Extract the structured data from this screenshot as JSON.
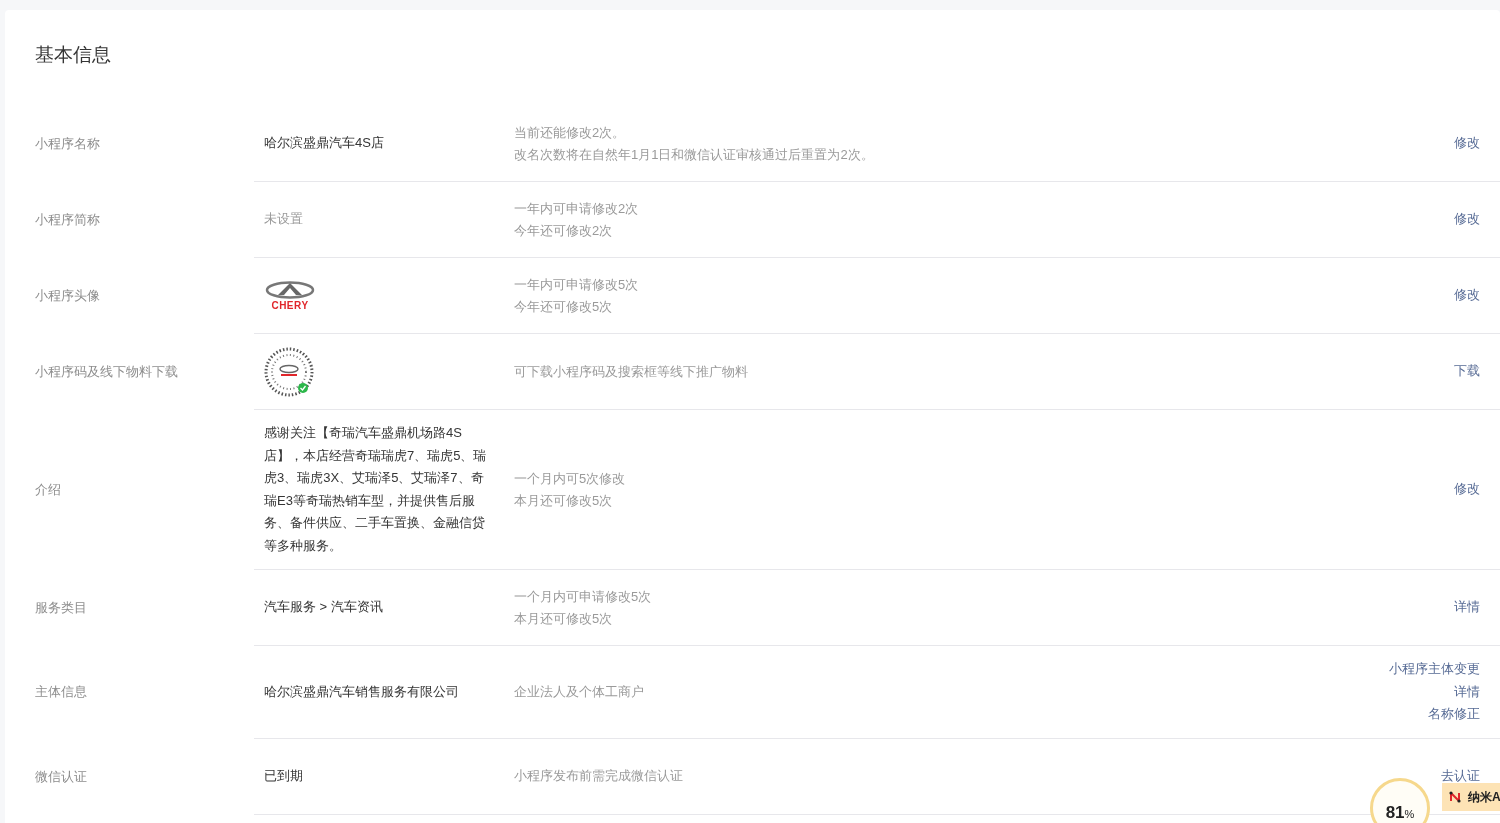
{
  "title": "基本信息",
  "rows": [
    {
      "label": "小程序名称",
      "value": {
        "kind": "text",
        "text": "哈尔滨盛鼎汽车4S店"
      },
      "notes": [
        "当前还能修改2次。",
        "改名次数将在自然年1月1日和微信认证审核通过后重置为2次。"
      ],
      "actions": [
        "修改"
      ]
    },
    {
      "label": "小程序简称",
      "value": {
        "kind": "muted",
        "text": "未设置"
      },
      "notes": [
        "一年内可申请修改2次",
        "今年还可修改2次"
      ],
      "actions": [
        "修改"
      ]
    },
    {
      "label": "小程序头像",
      "value": {
        "kind": "logo",
        "text": "CHERY"
      },
      "notes": [
        "一年内可申请修改5次",
        "今年还可修改5次"
      ],
      "actions": [
        "修改"
      ]
    },
    {
      "label": "小程序码及线下物料下载",
      "value": {
        "kind": "qrcode"
      },
      "notes": [
        "可下载小程序码及搜索框等线下推广物料"
      ],
      "actions": [
        "下载"
      ]
    },
    {
      "label": "介绍",
      "value": {
        "kind": "text",
        "text": "感谢关注【奇瑞汽车盛鼎机场路4S店】，本店经营奇瑞瑞虎7、瑞虎5、瑞虎3、瑞虎3X、艾瑞泽5、艾瑞泽7、奇瑞E3等奇瑞热销车型，并提供售后服务、备件供应、二手车置换、金融信贷等多种服务。"
      },
      "notes": [
        "一个月内可5次修改",
        "本月还可修改5次"
      ],
      "actions": [
        "修改"
      ]
    },
    {
      "label": "服务类目",
      "value": {
        "kind": "text",
        "text": "汽车服务 > 汽车资讯"
      },
      "notes": [
        "一个月内可申请修改5次",
        "本月还可修改5次"
      ],
      "actions": [
        "详情"
      ]
    },
    {
      "label": "主体信息",
      "value": {
        "kind": "text",
        "text": "哈尔滨盛鼎汽车销售服务有限公司"
      },
      "notes": [
        "企业法人及个体工商户"
      ],
      "actions": [
        "小程序主体变更",
        "详情",
        "名称修正"
      ]
    },
    {
      "label": "微信认证",
      "value": {
        "kind": "text",
        "text": "已到期"
      },
      "notes": [
        "小程序发布前需完成微信认证"
      ],
      "actions": [
        "去认证"
      ]
    }
  ],
  "floating_widget": {
    "percent": "81",
    "unit": "%",
    "tab_label": "纳米A"
  }
}
